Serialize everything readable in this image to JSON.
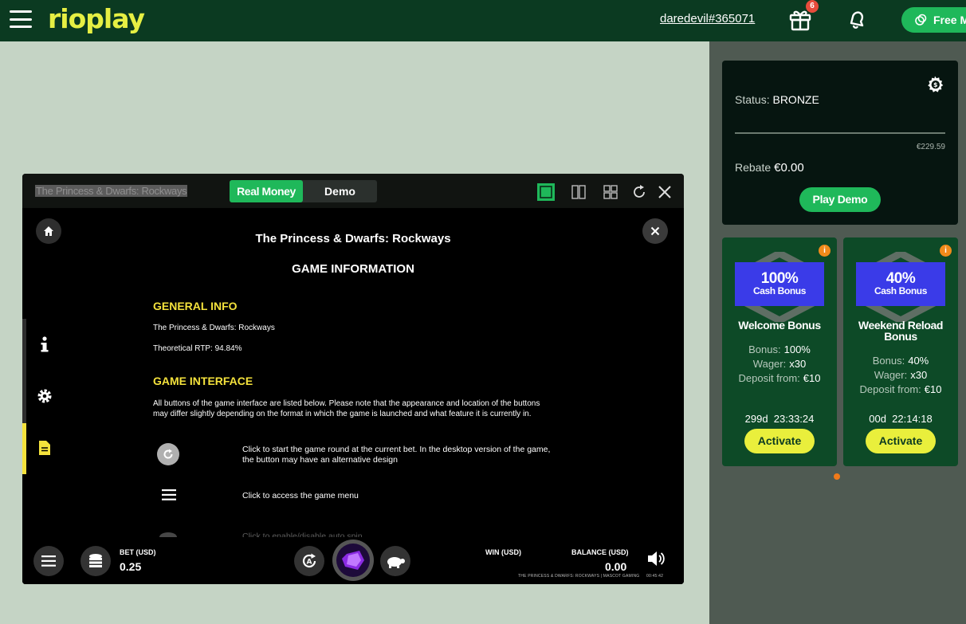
{
  "header": {
    "logo": "rioplay",
    "username": "daredevil#365071",
    "gift_badge": "6",
    "free_button": "Free M"
  },
  "status_card": {
    "status_label": "Status:",
    "status_value": "BRONZE",
    "progress_fraction": 0.0,
    "progress_amount": "€229.59",
    "rebate_label": "Rebate",
    "rebate_value": "€0.00",
    "play_demo": "Play Demo"
  },
  "bonuses": [
    {
      "percent": "100%",
      "tag": "Cash Bonus",
      "name": "Welcome Bonus",
      "bonus_label": "Bonus:",
      "bonus_value": "100%",
      "wager_label": "Wager:",
      "wager_value": "x30",
      "deposit_label": "Deposit from:",
      "deposit_value": "€10",
      "timer": "299d  23:33:24",
      "activate": "Activate"
    },
    {
      "percent": "40%",
      "tag": "Cash Bonus",
      "name": "Weekend Reload Bonus",
      "bonus_label": "Bonus:",
      "bonus_value": "40%",
      "wager_label": "Wager:",
      "wager_value": "x30",
      "deposit_label": "Deposit from:",
      "deposit_value": "€10",
      "timer": "00d  22:14:18",
      "activate": "Activate"
    }
  ],
  "game": {
    "window_title": "The Princess & Dwarfs: Rockways",
    "mode_real": "Real Money",
    "mode_demo": "Demo",
    "info_title": "The Princess & Dwarfs: Rockways",
    "info_subtitle": "GAME INFORMATION",
    "general_info_heading": "GENERAL INFO",
    "general_name": "The Princess & Dwarfs: Rockways",
    "rtp": "Theoretical RTP: 94.84%",
    "interface_heading": "GAME INTERFACE",
    "interface_intro": "All buttons of the game interface are listed below. Please note that the appearance and location of the buttons may differ slightly depending on the format in which the game is launched and what feature it is currently in.",
    "row1_text": "Click to start the game round at the current bet. In the desktop version of the game, the button may have an alternative design",
    "row2_text": "Click to access the game menu",
    "row3_text": "Click to enable/disable auto spin",
    "bet_label": "BET (USD)",
    "bet_value": "0.25",
    "win_label": "WIN (USD)",
    "balance_label": "BALANCE (USD)",
    "balance_value": "0.00",
    "footer_text": "THE PRINCESS & DWARFS: ROCKWAYS | MASCOT GAMING",
    "clock": "00:45:42"
  }
}
